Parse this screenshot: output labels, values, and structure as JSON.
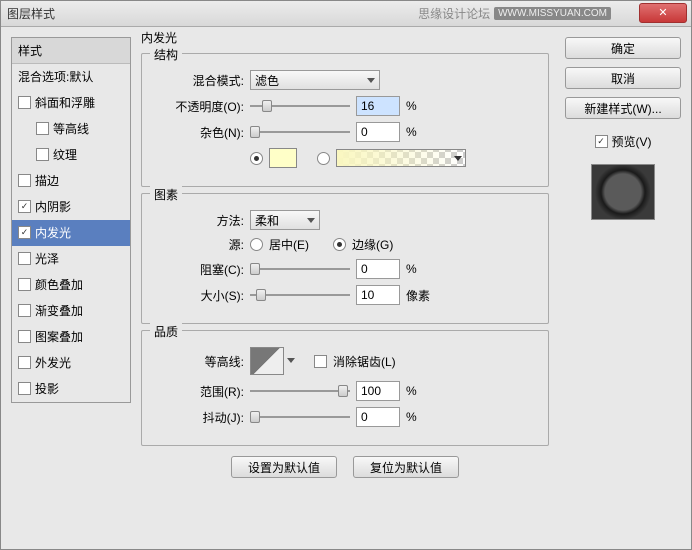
{
  "titlebar": {
    "title": "图层样式",
    "watermark": "思缘设计论坛",
    "watermark_badge": "WWW.MISSYUAN.COM"
  },
  "sidebar": {
    "header": "样式",
    "blend_opts": "混合选项:默认",
    "items": [
      {
        "label": "斜面和浮雕",
        "checked": false
      },
      {
        "label": "等高线",
        "checked": false,
        "sub": true
      },
      {
        "label": "纹理",
        "checked": false,
        "sub": true
      },
      {
        "label": "描边",
        "checked": false
      },
      {
        "label": "内阴影",
        "checked": true
      },
      {
        "label": "内发光",
        "checked": true,
        "selected": true
      },
      {
        "label": "光泽",
        "checked": false
      },
      {
        "label": "颜色叠加",
        "checked": false
      },
      {
        "label": "渐变叠加",
        "checked": false
      },
      {
        "label": "图案叠加",
        "checked": false
      },
      {
        "label": "外发光",
        "checked": false
      },
      {
        "label": "投影",
        "checked": false
      }
    ]
  },
  "panel_title": "内发光",
  "structure": {
    "title": "结构",
    "blend_mode_label": "混合模式:",
    "blend_mode_value": "滤色",
    "opacity_label": "不透明度(O):",
    "opacity_value": "16",
    "noise_label": "杂色(N):",
    "noise_value": "0",
    "percent": "%"
  },
  "elements": {
    "title": "图素",
    "technique_label": "方法:",
    "technique_value": "柔和",
    "source_label": "源:",
    "center_label": "居中(E)",
    "edge_label": "边缘(G)",
    "choke_label": "阻塞(C):",
    "choke_value": "0",
    "size_label": "大小(S):",
    "size_value": "10",
    "px": "像素",
    "percent": "%"
  },
  "quality": {
    "title": "品质",
    "contour_label": "等高线:",
    "antialias_label": "消除锯齿(L)",
    "range_label": "范围(R):",
    "range_value": "100",
    "jitter_label": "抖动(J):",
    "jitter_value": "0",
    "percent": "%"
  },
  "bottom_buttons": {
    "set_default": "设置为默认值",
    "reset_default": "复位为默认值"
  },
  "right": {
    "ok": "确定",
    "cancel": "取消",
    "new_style": "新建样式(W)...",
    "preview_label": "预览(V)"
  }
}
